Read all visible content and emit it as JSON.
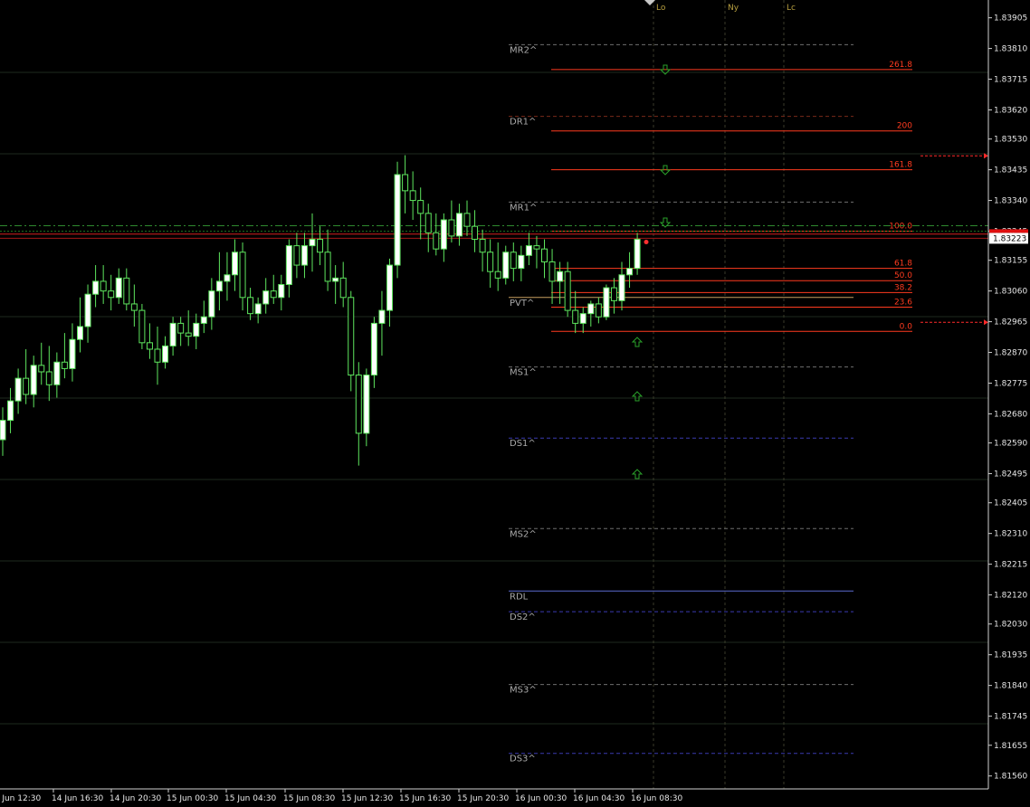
{
  "chart_data": {
    "type": "candlestick",
    "ylim": [
      1.8152,
      1.8396
    ],
    "y_ticks": [
      "1.83905",
      "1.83810",
      "1.83715",
      "1.83620",
      "1.83530",
      "1.83435",
      "1.83340",
      "1.83245",
      "1.83155",
      "1.83060",
      "1.82965",
      "1.82870",
      "1.82775",
      "1.82680",
      "1.82590",
      "1.82495",
      "1.82405",
      "1.82310",
      "1.82215",
      "1.82120",
      "1.82030",
      "1.81935",
      "1.81840",
      "1.81745",
      "1.81655",
      "1.81560"
    ],
    "current_price": "1.83223",
    "x_ticks": [
      "14 Jun 12:30",
      "14 Jun 16:30",
      "14 Jun 20:30",
      "15 Jun 00:30",
      "15 Jun 04:30",
      "15 Jun 08:30",
      "15 Jun 12:30",
      "15 Jun 16:30",
      "15 Jun 20:30",
      "16 Jun 00:30",
      "16 Jun 04:30",
      "16 Jun 08:30"
    ],
    "sessions": [
      "Lo",
      "Ny",
      "Lc"
    ],
    "pivot_levels": [
      {
        "label": "MR2^",
        "price": 1.83822,
        "color": "#6e6e6e"
      },
      {
        "label": "DR1^",
        "price": 1.836,
        "color": "#7a2a1a"
      },
      {
        "label": "MR1^",
        "price": 1.83335,
        "color": "#6e6e6e"
      },
      {
        "label": "PVT^",
        "price": 1.8304,
        "color": "#c8a060"
      },
      {
        "label": "MS1^",
        "price": 1.82825,
        "color": "#6e6e6e"
      },
      {
        "label": "DS1^",
        "price": 1.82605,
        "color": "#3a3ab0"
      },
      {
        "label": "MS2^",
        "price": 1.82325,
        "color": "#6e6e6e"
      },
      {
        "label": "RDL",
        "price": 1.82132,
        "color": "#5a6ad0"
      },
      {
        "label": "DS2^",
        "price": 1.82068,
        "color": "#3a3ab0"
      },
      {
        "label": "MS3^",
        "price": 1.81843,
        "color": "#6e6e6e"
      },
      {
        "label": "DS3^",
        "price": 1.8163,
        "color": "#3a3ab0"
      }
    ],
    "fib_levels": [
      {
        "label": "261.8",
        "price": 1.83745
      },
      {
        "label": "200",
        "price": 1.83555
      },
      {
        "label": "161.8",
        "price": 1.83435
      },
      {
        "label": "100.0",
        "price": 1.83245
      },
      {
        "label": "61.8",
        "price": 1.8313
      },
      {
        "label": "50.0",
        "price": 1.83092
      },
      {
        "label": "38.2",
        "price": 1.83055
      },
      {
        "label": "23.6",
        "price": 1.8301
      },
      {
        "label": "0.0",
        "price": 1.82935
      }
    ],
    "candles": [
      [
        1.826,
        1.827,
        1.8255,
        1.8266
      ],
      [
        1.8266,
        1.8276,
        1.8262,
        1.8272
      ],
      [
        1.8272,
        1.8282,
        1.8268,
        1.8279
      ],
      [
        1.8279,
        1.8288,
        1.8271,
        1.8274
      ],
      [
        1.8274,
        1.8286,
        1.827,
        1.8283
      ],
      [
        1.8283,
        1.829,
        1.8277,
        1.8281
      ],
      [
        1.8281,
        1.8289,
        1.8272,
        1.8277
      ],
      [
        1.8277,
        1.8287,
        1.8273,
        1.8284
      ],
      [
        1.8284,
        1.8293,
        1.8279,
        1.8282
      ],
      [
        1.8282,
        1.8296,
        1.8278,
        1.8291
      ],
      [
        1.8291,
        1.8304,
        1.8287,
        1.8295
      ],
      [
        1.8295,
        1.8308,
        1.829,
        1.8305
      ],
      [
        1.8305,
        1.8314,
        1.8301,
        1.8309
      ],
      [
        1.8309,
        1.8314,
        1.8302,
        1.8306
      ],
      [
        1.8306,
        1.8311,
        1.83,
        1.8304
      ],
      [
        1.8304,
        1.8313,
        1.8302,
        1.831
      ],
      [
        1.831,
        1.8313,
        1.83,
        1.8302
      ],
      [
        1.8302,
        1.8308,
        1.8295,
        1.83
      ],
      [
        1.83,
        1.8302,
        1.8288,
        1.829
      ],
      [
        1.829,
        1.8296,
        1.8285,
        1.8288
      ],
      [
        1.8288,
        1.8295,
        1.8277,
        1.8284
      ],
      [
        1.8284,
        1.8292,
        1.8282,
        1.8289
      ],
      [
        1.8289,
        1.8298,
        1.8286,
        1.8296
      ],
      [
        1.8296,
        1.8298,
        1.8289,
        1.8293
      ],
      [
        1.8293,
        1.83,
        1.8289,
        1.8292
      ],
      [
        1.8292,
        1.8299,
        1.8288,
        1.8296
      ],
      [
        1.8296,
        1.8303,
        1.8293,
        1.8298
      ],
      [
        1.8298,
        1.831,
        1.8294,
        1.8306
      ],
      [
        1.8306,
        1.8318,
        1.83,
        1.8309
      ],
      [
        1.8309,
        1.8318,
        1.8303,
        1.8311
      ],
      [
        1.8311,
        1.8322,
        1.8306,
        1.8318
      ],
      [
        1.8318,
        1.8321,
        1.83,
        1.8304
      ],
      [
        1.8304,
        1.8307,
        1.8297,
        1.8299
      ],
      [
        1.8299,
        1.8304,
        1.8296,
        1.8302
      ],
      [
        1.8302,
        1.831,
        1.8299,
        1.8306
      ],
      [
        1.8306,
        1.8311,
        1.8302,
        1.8304
      ],
      [
        1.8304,
        1.8311,
        1.83,
        1.8308
      ],
      [
        1.8308,
        1.8322,
        1.8304,
        1.832
      ],
      [
        1.832,
        1.8324,
        1.831,
        1.8314
      ],
      [
        1.8314,
        1.8324,
        1.831,
        1.832
      ],
      [
        1.832,
        1.833,
        1.8312,
        1.8322
      ],
      [
        1.8322,
        1.8326,
        1.8314,
        1.8318
      ],
      [
        1.8318,
        1.8325,
        1.8306,
        1.8309
      ],
      [
        1.8309,
        1.8314,
        1.8302,
        1.831
      ],
      [
        1.831,
        1.8315,
        1.8301,
        1.8304
      ],
      [
        1.8304,
        1.8306,
        1.8275,
        1.828
      ],
      [
        1.828,
        1.8284,
        1.8252,
        1.8262
      ],
      [
        1.8262,
        1.8282,
        1.8258,
        1.828
      ],
      [
        1.828,
        1.8298,
        1.8276,
        1.8296
      ],
      [
        1.8296,
        1.8306,
        1.8286,
        1.83
      ],
      [
        1.83,
        1.8316,
        1.8295,
        1.8314
      ],
      [
        1.8314,
        1.8346,
        1.831,
        1.8342
      ],
      [
        1.8342,
        1.8348,
        1.833,
        1.8337
      ],
      [
        1.8337,
        1.8343,
        1.8328,
        1.8334
      ],
      [
        1.8334,
        1.8338,
        1.8322,
        1.833
      ],
      [
        1.833,
        1.8333,
        1.8318,
        1.8324
      ],
      [
        1.8324,
        1.833,
        1.8317,
        1.8319
      ],
      [
        1.8319,
        1.833,
        1.8315,
        1.8328
      ],
      [
        1.8328,
        1.8334,
        1.8321,
        1.8323
      ],
      [
        1.8323,
        1.8333,
        1.832,
        1.833
      ],
      [
        1.833,
        1.8334,
        1.8323,
        1.8326
      ],
      [
        1.8326,
        1.8331,
        1.8318,
        1.8322
      ],
      [
        1.8322,
        1.8325,
        1.8312,
        1.8318
      ],
      [
        1.8318,
        1.8322,
        1.8307,
        1.8312
      ],
      [
        1.8312,
        1.8321,
        1.8306,
        1.831
      ],
      [
        1.831,
        1.832,
        1.8308,
        1.8318
      ],
      [
        1.8318,
        1.8321,
        1.8309,
        1.8313
      ],
      [
        1.8313,
        1.832,
        1.8309,
        1.8317
      ],
      [
        1.8317,
        1.8324,
        1.8314,
        1.832
      ],
      [
        1.832,
        1.8323,
        1.8313,
        1.8319
      ],
      [
        1.8319,
        1.8322,
        1.831,
        1.8315
      ],
      [
        1.8315,
        1.8319,
        1.8302,
        1.8309
      ],
      [
        1.8309,
        1.8315,
        1.8302,
        1.8312
      ],
      [
        1.8312,
        1.8315,
        1.8298,
        1.83
      ],
      [
        1.83,
        1.8306,
        1.8293,
        1.8296
      ],
      [
        1.8296,
        1.8301,
        1.8293,
        1.8299
      ],
      [
        1.8299,
        1.8303,
        1.8295,
        1.8302
      ],
      [
        1.8302,
        1.8304,
        1.8296,
        1.8298
      ],
      [
        1.8298,
        1.8308,
        1.8297,
        1.8307
      ],
      [
        1.8307,
        1.831,
        1.8299,
        1.8303
      ],
      [
        1.8303,
        1.8315,
        1.83,
        1.8311
      ],
      [
        1.8311,
        1.8318,
        1.8307,
        1.8313
      ],
      [
        1.8313,
        1.8324,
        1.8311,
        1.8322
      ]
    ]
  }
}
